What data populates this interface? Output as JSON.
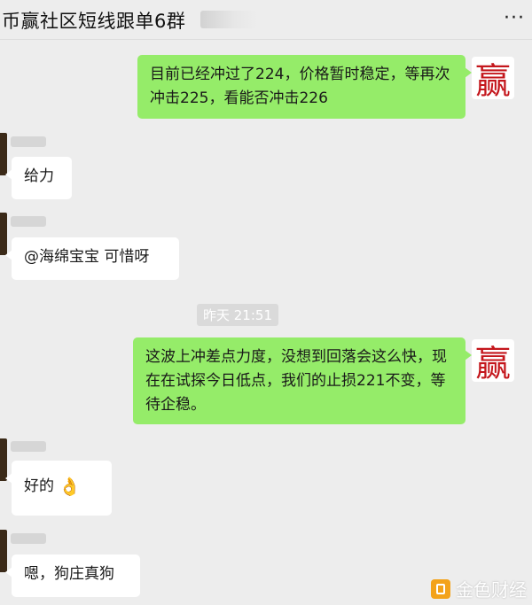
{
  "header": {
    "title": "币赢社区短线跟单6群",
    "more_icon": "more-icon"
  },
  "messages": [
    {
      "side": "right",
      "text": "目前已经冲过了224，价格暂时稳定，等再次冲击225，看能否冲击226",
      "avatar_text": "赢"
    },
    {
      "side": "left",
      "text": "给力"
    },
    {
      "side": "left",
      "text": "@海绵宝宝 可惜呀"
    },
    {
      "side": "right",
      "text": "这波上冲差点力度，没想到回落会这么快，现在在试探今日低点，我们的止损221不变，等待企稳。",
      "avatar_text": "赢"
    },
    {
      "side": "left",
      "text": "好的",
      "emoji": "👌"
    },
    {
      "side": "left",
      "text": "嗯，狗庄真狗"
    }
  ],
  "timestamp": "昨天 21:51",
  "watermark": "金色财经",
  "colors": {
    "green_bubble": "#95ec69",
    "background": "#ededed",
    "brand_red": "#c4161c"
  }
}
